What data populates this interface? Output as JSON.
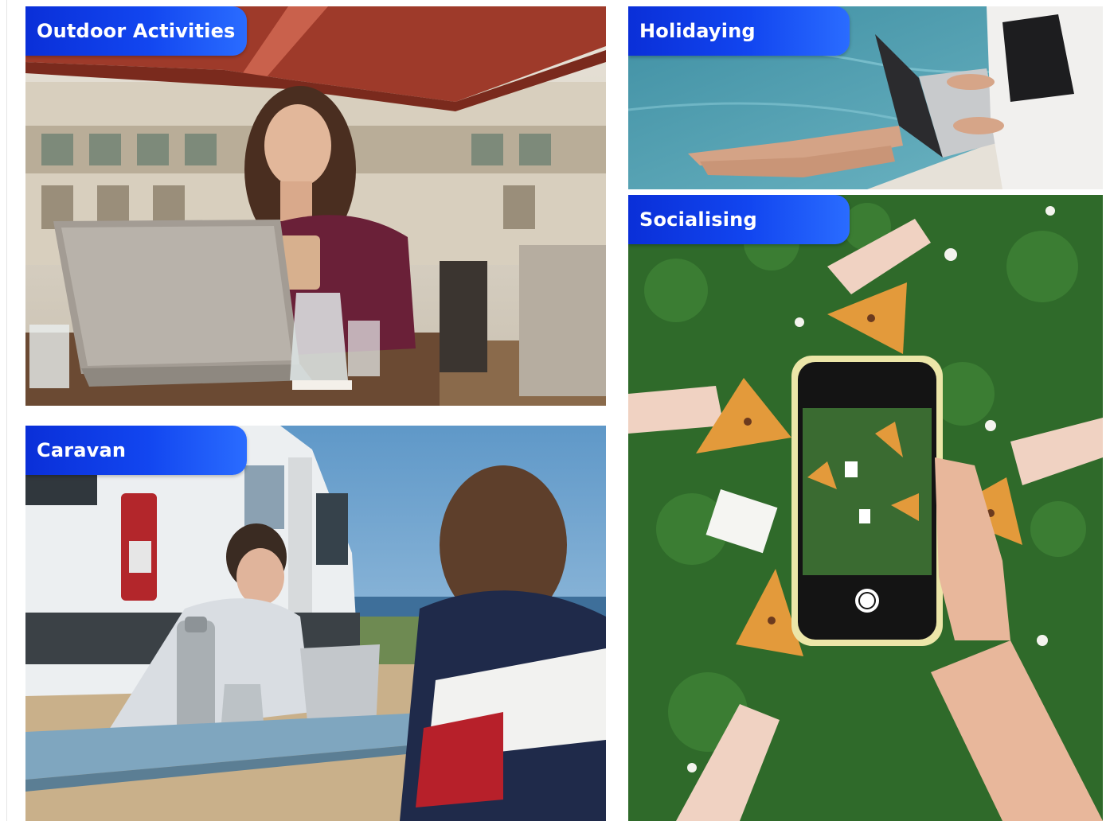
{
  "tiles": {
    "outdoor": {
      "label": "Outdoor Activities"
    },
    "holidaying": {
      "label": "Holidaying"
    },
    "caravan": {
      "label": "Caravan"
    },
    "socialising": {
      "label": "Socialising"
    }
  },
  "colors": {
    "tag_start": "#0a2fd8",
    "tag_end": "#2a6cff",
    "tag_text": "#ffffff",
    "background": "#ffffff"
  }
}
